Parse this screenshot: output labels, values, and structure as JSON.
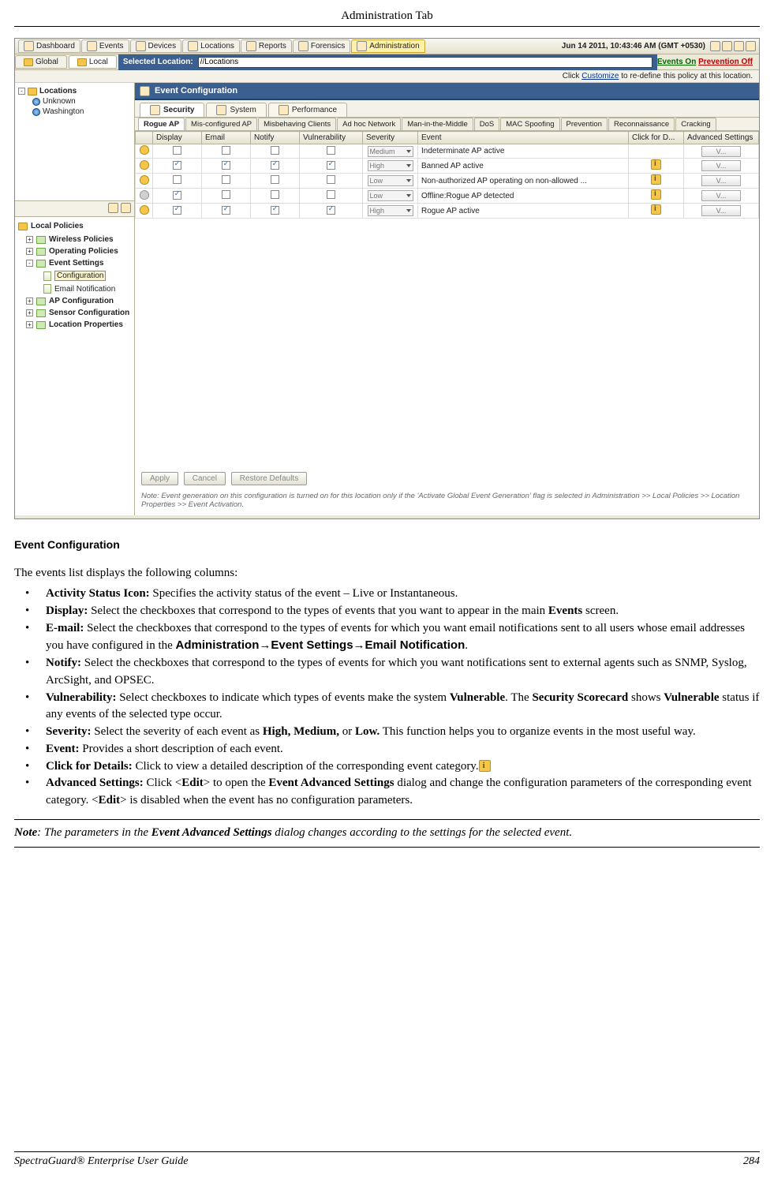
{
  "doc": {
    "header": "Administration Tab",
    "section_title": "Event Configuration",
    "intro": "The events list displays the following columns:",
    "bullets": [
      {
        "b": "Activity Status Icon:",
        "t": " Specifies the activity status of the event – Live or Instantaneous."
      },
      {
        "b": "Display:",
        "t": " Select the checkboxes that correspond to the types of events that you want to appear in the main ",
        "b2": "Events",
        "t2": " screen."
      },
      {
        "b": "E-mail:",
        "t": " Select the checkboxes that correspond to the types of events for which you want email notifications sent to all users whose email addresses you have configured in the ",
        "path": "Administration→Event Settings→Email Notification",
        "t2": "."
      },
      {
        "b": "Notify:",
        "t": " Select the checkboxes that correspond to the types of events for which you want notifications sent to external agents such as SNMP, Syslog, ArcSight, and OPSEC."
      },
      {
        "b": "Vulnerability:",
        "t": " Select checkboxes to indicate which types of events make the system ",
        "b2": "Vulnerable",
        "t2": ". The ",
        "b3": "Security Scorecard",
        "t3": " shows ",
        "b4": "Vulnerable",
        "t4": " status if any events of the selected type occur."
      },
      {
        "b": "Severity:",
        "t": " Select the severity of each event as ",
        "b2": "High, Medium,",
        "t2": " or ",
        "b3": "Low.",
        "t3": " This function helps you to organize events in the most useful way."
      },
      {
        "b": "Event:",
        "t": " Provides a short description of each event."
      },
      {
        "b": "Click for Details:",
        "t": " Click ",
        "icon": true,
        "t2": " to view a detailed description of the corresponding event category."
      },
      {
        "b": "Advanced Settings:",
        "t": " Click <",
        "b2": "Edit",
        "t2": "> to open the ",
        "b3": "Event Advanced Settings",
        "t3": " dialog and change the configuration parameters of the corresponding event category. <",
        "b4": "Edit",
        "t4": "> is disabled when the event has no configuration parameters."
      }
    ],
    "note_prefix": "Note",
    "note_text": ": The parameters in the ",
    "note_b": "Event Advanced Settings",
    "note_suffix": " dialog changes according to the settings for the selected event.",
    "footer_left": "SpectraGuard® Enterprise User Guide",
    "footer_right": "284"
  },
  "app": {
    "time": "Jun 14 2011, 10:43:46 AM (GMT +0530)",
    "top_tabs": [
      "Dashboard",
      "Events",
      "Devices",
      "Locations",
      "Reports",
      "Forensics",
      "Administration"
    ],
    "gl_tabs": [
      "Global",
      "Local"
    ],
    "sel_loc_label": "Selected Location:",
    "sel_loc_value": "//Locations",
    "events_on": "Events On",
    "prev_off": "Prevention Off",
    "customize_pre": "Click ",
    "customize_link": "Customize",
    "customize_post": " to re-define this policy at this location.",
    "tree": {
      "root": "Locations",
      "children": [
        "Unknown",
        "Washington"
      ]
    },
    "policies_title": "Local Policies",
    "policies": [
      "Wireless Policies",
      "Operating Policies",
      "Event Settings",
      "AP Configuration",
      "Sensor Configuration",
      "Location Properties"
    ],
    "policy_subs": [
      "Configuration",
      "Email Notification"
    ],
    "ec_title": "Event Configuration",
    "sec_tabs": [
      "Security",
      "System",
      "Performance"
    ],
    "sub_tabs": [
      "Rogue AP",
      "Mis-configured AP",
      "Misbehaving Clients",
      "Ad hoc Network",
      "Man-in-the-Middle",
      "DoS",
      "MAC Spoofing",
      "Prevention",
      "Reconnaissance",
      "Cracking"
    ],
    "grid_headers": [
      "",
      "Display",
      "Email",
      "Notify",
      "Vulnerability",
      "Severity",
      "Event",
      "Click for D...",
      "Advanced Settings"
    ],
    "rows": [
      {
        "icon": "bell",
        "d": false,
        "e": false,
        "n": false,
        "v": false,
        "sev": "Medium",
        "ev": "Indeterminate AP active",
        "info": false,
        "adv": "V..."
      },
      {
        "icon": "bell",
        "d": true,
        "e": true,
        "n": true,
        "v": true,
        "sev": "High",
        "ev": "Banned AP active",
        "info": true,
        "adv": "V..."
      },
      {
        "icon": "bell",
        "d": false,
        "e": false,
        "n": false,
        "v": false,
        "sev": "Low",
        "ev": "Non-authorized AP operating on non-allowed ...",
        "info": true,
        "adv": "V..."
      },
      {
        "icon": "bell-gray",
        "d": true,
        "e": false,
        "n": false,
        "v": false,
        "sev": "Low",
        "ev": "Offline:Rogue AP detected",
        "info": true,
        "adv": "V..."
      },
      {
        "icon": "bell",
        "d": true,
        "e": true,
        "n": true,
        "v": true,
        "sev": "High",
        "ev": "Rogue AP active",
        "info": true,
        "adv": "V..."
      }
    ],
    "buttons": {
      "apply": "Apply",
      "cancel": "Cancel",
      "restore": "Restore Defaults"
    },
    "grid_note": "Note: Event generation on this configuration is turned on for this location only if the 'Activate Global Event Generation' flag is selected in Administration >> Local Policies >> Location Properties >> Event Activation."
  }
}
